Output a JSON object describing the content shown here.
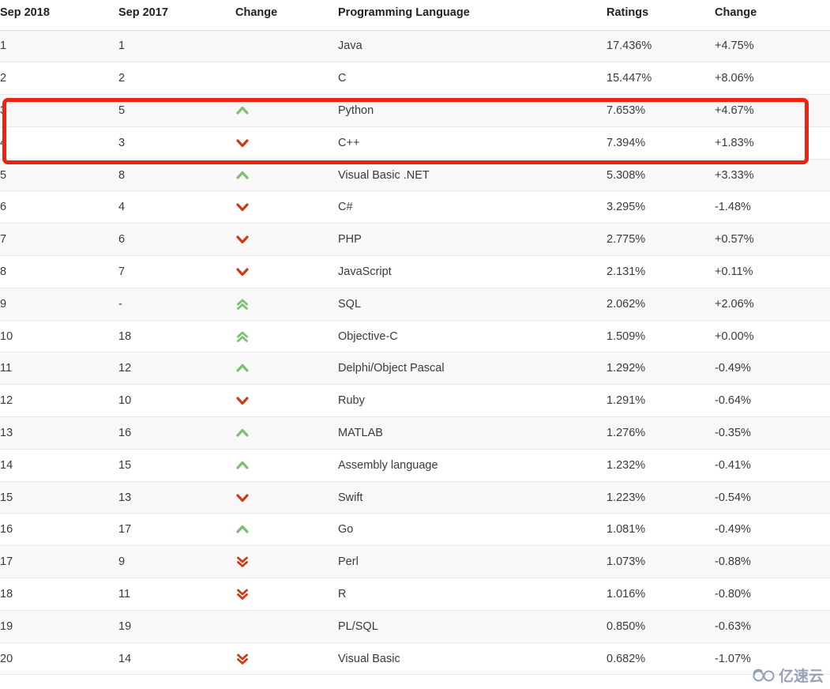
{
  "table": {
    "columns": [
      {
        "key": "rank_new",
        "label": "Sep 2018"
      },
      {
        "key": "rank_old",
        "label": "Sep 2017"
      },
      {
        "key": "change",
        "label": "Change"
      },
      {
        "key": "language",
        "label": "Programming Language"
      },
      {
        "key": "ratings",
        "label": "Ratings"
      },
      {
        "key": "delta",
        "label": "Change"
      }
    ],
    "rows": [
      {
        "rank_new": "1",
        "rank_old": "1",
        "change": "none",
        "language": "Java",
        "ratings": "17.436%",
        "delta": "+4.75%"
      },
      {
        "rank_new": "2",
        "rank_old": "2",
        "change": "none",
        "language": "C",
        "ratings": "15.447%",
        "delta": "+8.06%"
      },
      {
        "rank_new": "3",
        "rank_old": "5",
        "change": "up",
        "language": "Python",
        "ratings": "7.653%",
        "delta": "+4.67%"
      },
      {
        "rank_new": "4",
        "rank_old": "3",
        "change": "down",
        "language": "C++",
        "ratings": "7.394%",
        "delta": "+1.83%"
      },
      {
        "rank_new": "5",
        "rank_old": "8",
        "change": "up",
        "language": "Visual Basic .NET",
        "ratings": "5.308%",
        "delta": "+3.33%"
      },
      {
        "rank_new": "6",
        "rank_old": "4",
        "change": "down",
        "language": "C#",
        "ratings": "3.295%",
        "delta": "-1.48%"
      },
      {
        "rank_new": "7",
        "rank_old": "6",
        "change": "down",
        "language": "PHP",
        "ratings": "2.775%",
        "delta": "+0.57%"
      },
      {
        "rank_new": "8",
        "rank_old": "7",
        "change": "down",
        "language": "JavaScript",
        "ratings": "2.131%",
        "delta": "+0.11%"
      },
      {
        "rank_new": "9",
        "rank_old": "-",
        "change": "up-double",
        "language": "SQL",
        "ratings": "2.062%",
        "delta": "+2.06%"
      },
      {
        "rank_new": "10",
        "rank_old": "18",
        "change": "up-double",
        "language": "Objective-C",
        "ratings": "1.509%",
        "delta": "+0.00%"
      },
      {
        "rank_new": "11",
        "rank_old": "12",
        "change": "up",
        "language": "Delphi/Object Pascal",
        "ratings": "1.292%",
        "delta": "-0.49%"
      },
      {
        "rank_new": "12",
        "rank_old": "10",
        "change": "down",
        "language": "Ruby",
        "ratings": "1.291%",
        "delta": "-0.64%"
      },
      {
        "rank_new": "13",
        "rank_old": "16",
        "change": "up",
        "language": "MATLAB",
        "ratings": "1.276%",
        "delta": "-0.35%"
      },
      {
        "rank_new": "14",
        "rank_old": "15",
        "change": "up",
        "language": "Assembly language",
        "ratings": "1.232%",
        "delta": "-0.41%"
      },
      {
        "rank_new": "15",
        "rank_old": "13",
        "change": "down",
        "language": "Swift",
        "ratings": "1.223%",
        "delta": "-0.54%"
      },
      {
        "rank_new": "16",
        "rank_old": "17",
        "change": "up",
        "language": "Go",
        "ratings": "1.081%",
        "delta": "-0.49%"
      },
      {
        "rank_new": "17",
        "rank_old": "9",
        "change": "down-double",
        "language": "Perl",
        "ratings": "1.073%",
        "delta": "-0.88%"
      },
      {
        "rank_new": "18",
        "rank_old": "11",
        "change": "down-double",
        "language": "R",
        "ratings": "1.016%",
        "delta": "-0.80%"
      },
      {
        "rank_new": "19",
        "rank_old": "19",
        "change": "none",
        "language": "PL/SQL",
        "ratings": "0.850%",
        "delta": "-0.63%"
      },
      {
        "rank_new": "20",
        "rank_old": "14",
        "change": "down-double",
        "language": "Visual Basic",
        "ratings": "0.682%",
        "delta": "-1.07%"
      }
    ]
  },
  "highlight": {
    "color": "#ee2211",
    "covers_rows": [
      "Python",
      "C++"
    ]
  },
  "icons": {
    "up": "chevron-up-icon",
    "down": "chevron-down-icon",
    "up-double": "chevron-double-up-icon",
    "down-double": "chevron-double-down-icon",
    "colors": {
      "up": "#7dbf72",
      "down": "#cf3b16"
    }
  },
  "watermark": {
    "text": "亿速云",
    "logo": "glasses-logo-icon",
    "color": "#8d9bb0"
  }
}
